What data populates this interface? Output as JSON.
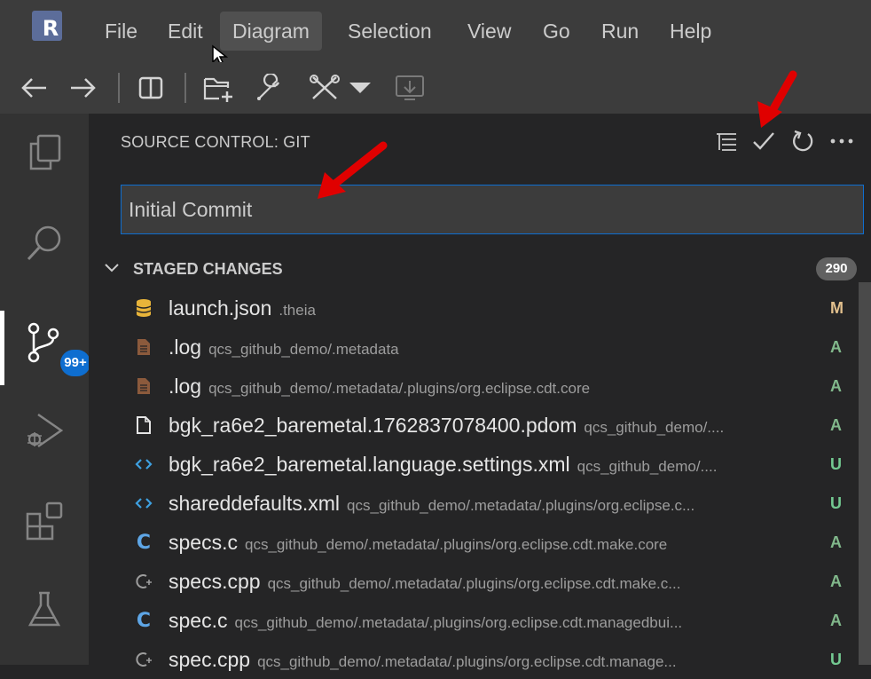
{
  "menubar": {
    "logo_letter": "R",
    "items": [
      "File",
      "Edit",
      "Diagram",
      "Selection",
      "View",
      "Go",
      "Run",
      "Help"
    ]
  },
  "toolbar": {
    "icons": [
      "back-arrow-icon",
      "forward-arrow-icon",
      "split-editor-icon",
      "new-folder-icon",
      "wrench-icon",
      "tools-icon",
      "chevron-down-icon",
      "monitor-download-icon"
    ]
  },
  "activity": {
    "badge": "99+"
  },
  "scm": {
    "title": "SOURCE CONTROL: GIT",
    "commit_message": "Initial Commit",
    "section_title": "STAGED CHANGES",
    "count": "290",
    "files": [
      {
        "name": "launch.json",
        "path": ".theia",
        "status": "M",
        "icon": "database-icon"
      },
      {
        "name": ".log",
        "path": "qcs_github_demo/.metadata",
        "status": "A",
        "icon": "log-file-icon"
      },
      {
        "name": ".log",
        "path": "qcs_github_demo/.metadata/.plugins/org.eclipse.cdt.core",
        "status": "A",
        "icon": "log-file-icon"
      },
      {
        "name": "bgk_ra6e2_baremetal.1762837078400.pdom",
        "path": "qcs_github_demo/....",
        "status": "A",
        "icon": "file-icon"
      },
      {
        "name": "bgk_ra6e2_baremetal.language.settings.xml",
        "path": "qcs_github_demo/....",
        "status": "U",
        "icon": "xml-icon"
      },
      {
        "name": "shareddefaults.xml",
        "path": "qcs_github_demo/.metadata/.plugins/org.eclipse.c...",
        "status": "U",
        "icon": "xml-icon"
      },
      {
        "name": "specs.c",
        "path": "qcs_github_demo/.metadata/.plugins/org.eclipse.cdt.make.core",
        "status": "A",
        "icon": "c-file-icon"
      },
      {
        "name": "specs.cpp",
        "path": "qcs_github_demo/.metadata/.plugins/org.eclipse.cdt.make.c...",
        "status": "A",
        "icon": "cpp-file-icon"
      },
      {
        "name": "spec.c",
        "path": "qcs_github_demo/.metadata/.plugins/org.eclipse.cdt.managedbui...",
        "status": "A",
        "icon": "c-file-icon"
      },
      {
        "name": "spec.cpp",
        "path": "qcs_github_demo/.metadata/.plugins/org.eclipse.cdt.manage...",
        "status": "U",
        "icon": "cpp-file-icon"
      }
    ]
  },
  "colors": {
    "status_modified": "#e2c08d",
    "status_added": "#81b88b",
    "status_untracked": "#73c991",
    "accent": "#0e6ed0",
    "annotation_arrow": "#e00000"
  }
}
